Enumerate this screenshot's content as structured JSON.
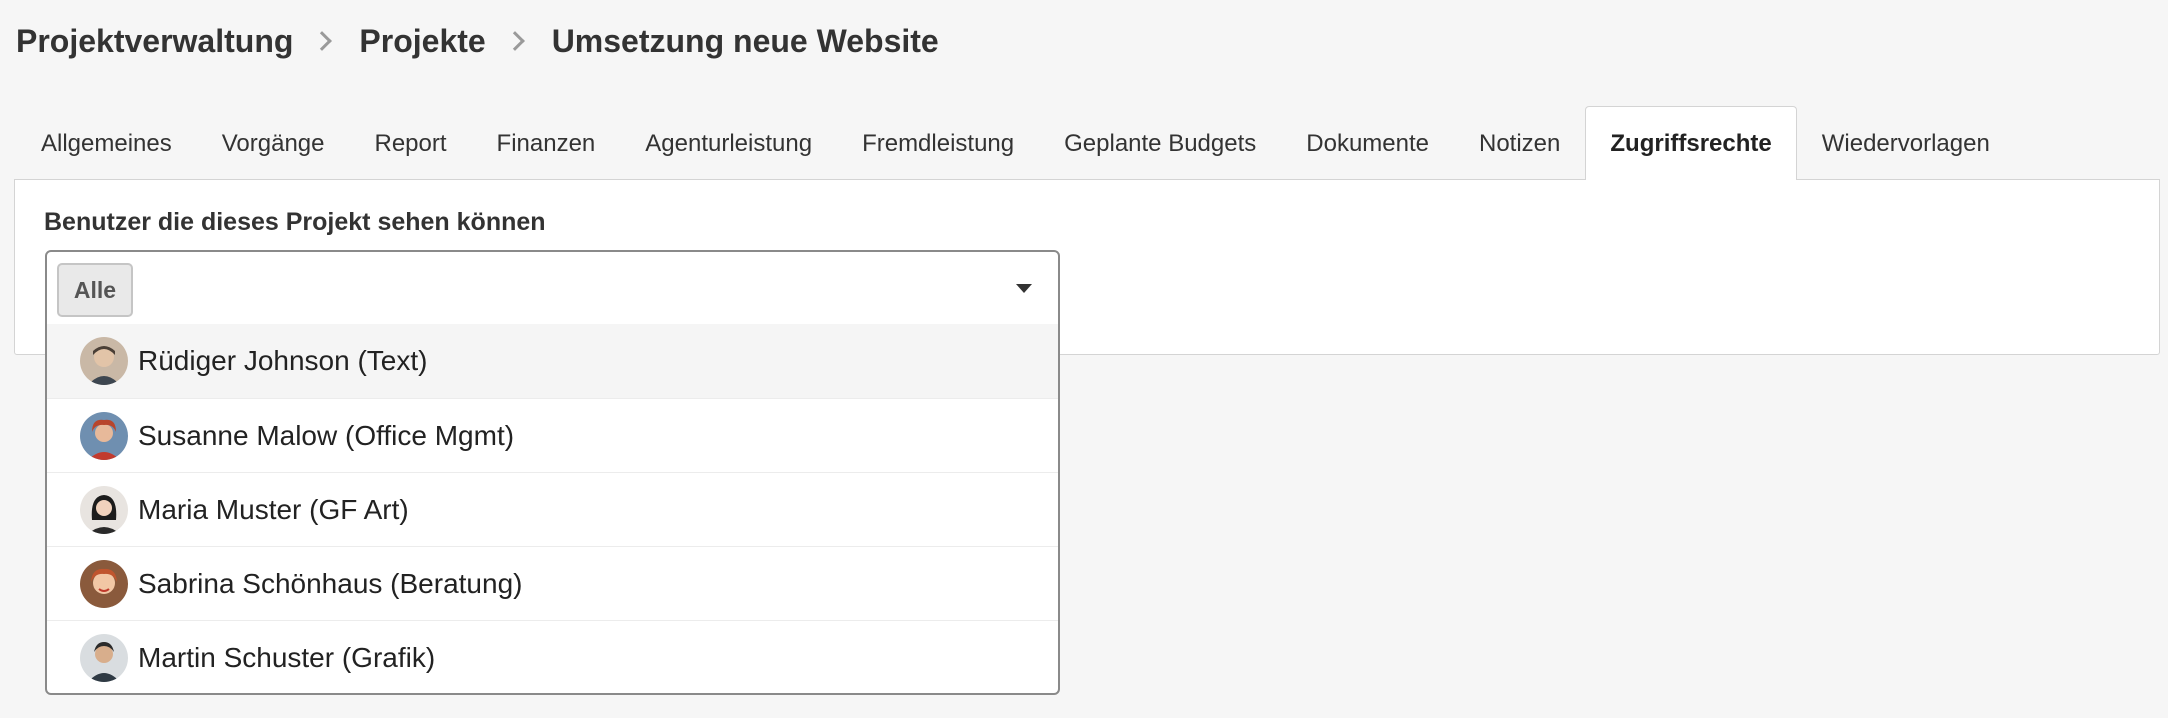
{
  "breadcrumb": {
    "items": [
      "Projektverwaltung",
      "Projekte",
      "Umsetzung neue Website"
    ]
  },
  "tabs": [
    {
      "label": "Allgemeines",
      "active": false
    },
    {
      "label": "Vorgänge",
      "active": false
    },
    {
      "label": "Report",
      "active": false
    },
    {
      "label": "Finanzen",
      "active": false
    },
    {
      "label": "Agenturleistung",
      "active": false
    },
    {
      "label": "Fremdleistung",
      "active": false
    },
    {
      "label": "Geplante Budgets",
      "active": false
    },
    {
      "label": "Dokumente",
      "active": false
    },
    {
      "label": "Notizen",
      "active": false
    },
    {
      "label": "Zugriffsrechte",
      "active": true
    },
    {
      "label": "Wiedervorlagen",
      "active": false
    }
  ],
  "access": {
    "label": "Benutzer die dieses Projekt sehen können",
    "selected_chip": "Alle",
    "options": [
      {
        "label": "Rüdiger Johnson (Text)",
        "avatar": "user-avatar",
        "bg": "#c9b8a6",
        "hair": "#4a3f36"
      },
      {
        "label": "Susanne Malow (Office Mgmt)",
        "avatar": "user-avatar",
        "bg": "#6f8fb0",
        "hair": "#b8452c"
      },
      {
        "label": "Maria Muster (GF Art)",
        "avatar": "user-avatar",
        "bg": "#e8e4e0",
        "hair": "#1c1c1c"
      },
      {
        "label": "Sabrina Schönhaus (Beratung)",
        "avatar": "user-avatar",
        "bg": "#8a5a3c",
        "hair": "#c0552e"
      },
      {
        "label": "Martin Schuster (Grafik)",
        "avatar": "user-avatar",
        "bg": "#d9dde0",
        "hair": "#2b2b2b"
      }
    ]
  },
  "colors": {
    "background": "#f6f6f6",
    "panel": "#ffffff",
    "border": "#d4d4d4",
    "text": "#333333"
  }
}
